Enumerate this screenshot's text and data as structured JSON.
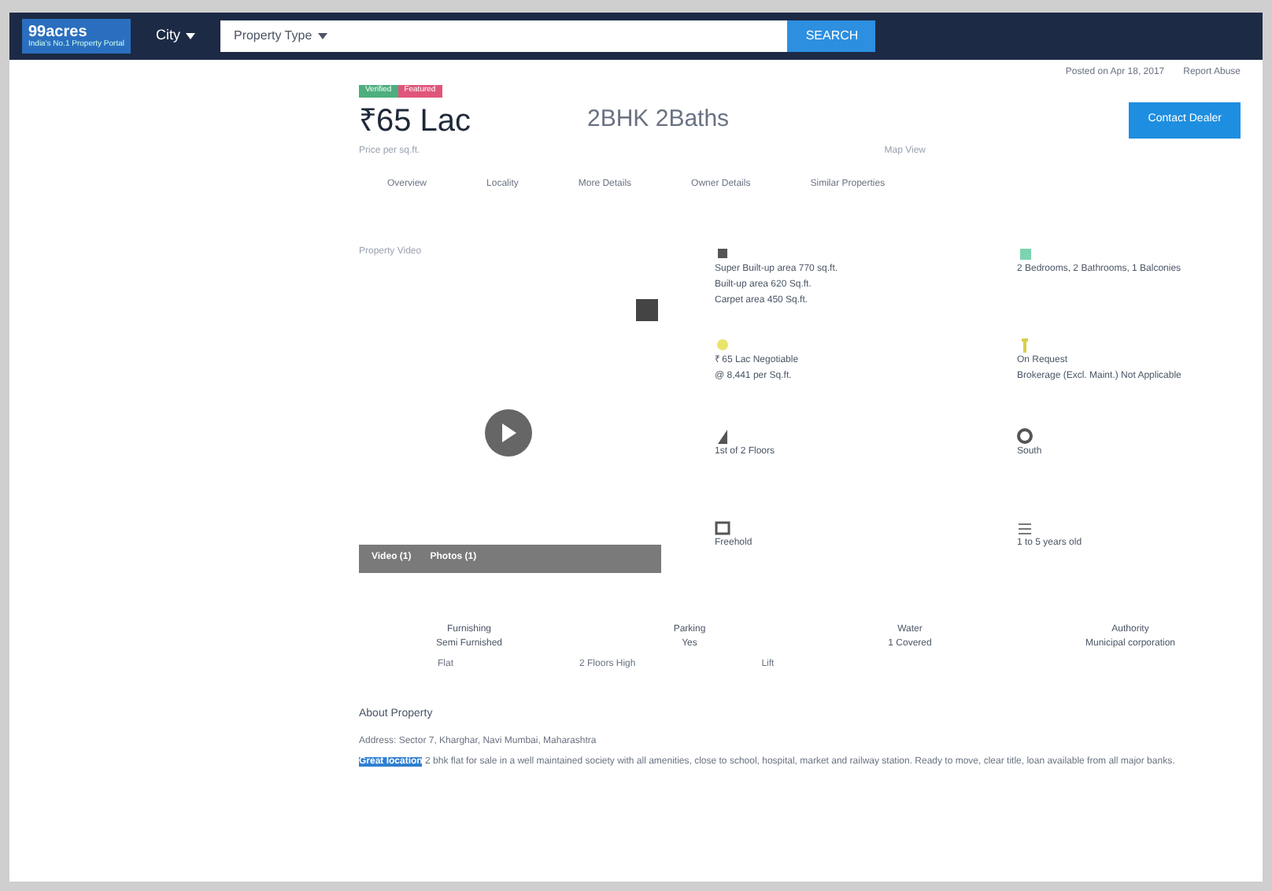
{
  "header": {
    "logo": "99acres",
    "tagline": "India's No.1 Property Portal",
    "city": "City",
    "property_type": "Property Type",
    "search_button": "SEARCH"
  },
  "top_links": [
    "Posted on Apr 18, 2017",
    "Report Abuse"
  ],
  "tags": [
    {
      "label": "Verified",
      "color": "#4caf7d"
    },
    {
      "label": "Featured",
      "color": "#e0567a"
    }
  ],
  "price": "₹65 Lac",
  "config": "2BHK 2Baths",
  "price_note": "Price per sq.ft.",
  "locality_note": "Map View",
  "contact_button": "Contact Dealer",
  "tabs": [
    {
      "label": "Overview",
      "selected": false
    },
    {
      "label": "Locality",
      "selected": false
    },
    {
      "label": "More Details",
      "selected": false
    },
    {
      "label": "Owner Details",
      "selected": false
    },
    {
      "label": "Similar Properties",
      "selected": false
    }
  ],
  "media": {
    "caption": "Property Video",
    "video_count": "Video (1)",
    "photo_count": "Photos (1)"
  },
  "facts": [
    {
      "lines": [
        "Super Built-up area 770 sq.ft.",
        "Built-up area 620 Sq.ft.",
        "Carpet area 450 Sq.ft."
      ]
    },
    {
      "lines": [
        "2 Bedrooms, 2 Bathrooms, 1 Balconies"
      ]
    },
    {
      "lines": [
        "₹ 65 Lac Negotiable",
        "@ 8,441 per Sq.ft."
      ]
    },
    {
      "lines": [
        "On Request",
        "Brokerage (Excl. Maint.) Not Applicable"
      ]
    },
    {
      "lines": [
        "1st of 2 Floors"
      ]
    },
    {
      "lines": [
        "South"
      ]
    },
    {
      "lines": [
        "Freehold"
      ]
    },
    {
      "lines": [
        "1 to 5 years old"
      ]
    }
  ],
  "details": [
    {
      "label": "Furnishing",
      "value": "Semi Furnished"
    },
    {
      "label": "Parking",
      "value": "Yes"
    },
    {
      "label": "Water",
      "value": "1 Covered"
    },
    {
      "label": "Authority",
      "value": "Municipal corporation"
    }
  ],
  "extra": [
    "Flat",
    "2 Floors High",
    "Lift"
  ],
  "about": {
    "heading": "About Property",
    "address": "Address: Sector 7, Kharghar, Navi Mumbai, Maharashtra",
    "description": "**Great location** 2 bhk flat for sale in a well maintained society with all amenities, close to school, hospital, market and railway station. Ready to move, clear title, loan available from all major banks."
  }
}
